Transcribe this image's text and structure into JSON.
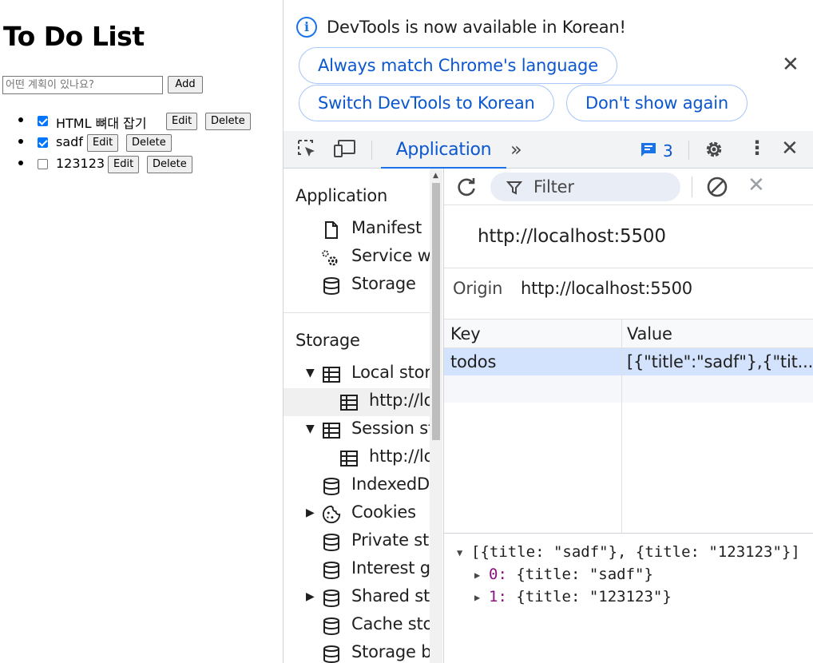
{
  "page": {
    "title": "To Do List",
    "input_placeholder": "어떤 계획이 있나요?",
    "add_label": "Add",
    "todos": [
      {
        "title": "HTML 뼈대 잡기",
        "checked": true,
        "edit_label": "Edit",
        "delete_label": "Delete"
      },
      {
        "title": "sadf",
        "checked": true,
        "edit_label": "Edit",
        "delete_label": "Delete"
      },
      {
        "title": "123123",
        "checked": false,
        "edit_label": "Edit",
        "delete_label": "Delete"
      }
    ]
  },
  "devtools": {
    "infobar": {
      "message": "DevTools is now available in Korean!",
      "match_label": "Always match Chrome's language",
      "switch_label": "Switch DevTools to Korean",
      "dont_show_label": "Don't show again"
    },
    "toolbar": {
      "active_tab": "Application",
      "issues_count": "3"
    },
    "sidebar": {
      "application_header": "Application",
      "application_items": [
        "Manifest",
        "Service w",
        "Storage"
      ],
      "storage_header": "Storage",
      "storage_items": [
        {
          "label": "Local stor",
          "expanded": true
        },
        {
          "label": "http://lo",
          "child": true,
          "selected": true
        },
        {
          "label": "Session st",
          "expanded": true
        },
        {
          "label": "http://lo",
          "child": true
        },
        {
          "label": "IndexedD"
        },
        {
          "label": "Cookies",
          "collapsed": true
        },
        {
          "label": "Private sta"
        },
        {
          "label": "Interest g"
        },
        {
          "label": "Shared st",
          "collapsed": true
        },
        {
          "label": "Cache sto"
        },
        {
          "label": "Storage b"
        }
      ]
    },
    "main": {
      "filter_placeholder": "Filter",
      "origin_header": "http://localhost:5500",
      "origin_label": "Origin",
      "origin_value": "http://localhost:5500",
      "table": {
        "key_header": "Key",
        "value_header": "Value",
        "rows": [
          {
            "key": "todos",
            "value": "[{\"title\":\"sadf\"},{\"tit..."
          }
        ]
      },
      "preview": {
        "root": "[{title: \"sadf\"}, {title: \"123123\"}]",
        "items": [
          {
            "index": "0",
            "value": "{title: \"sadf\"}"
          },
          {
            "index": "1",
            "value": "{title: \"123123\"}"
          }
        ]
      }
    }
  }
}
